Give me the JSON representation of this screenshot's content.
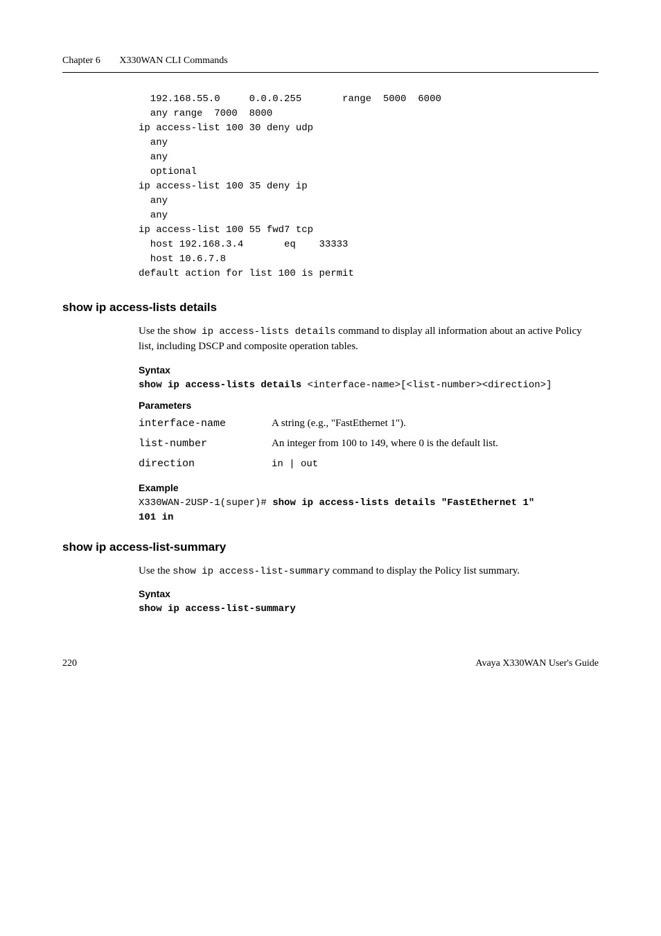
{
  "header": {
    "chapter": "Chapter 6",
    "title": "X330WAN CLI Commands"
  },
  "code_top": "  192.168.55.0     0.0.0.255       range  5000  6000\n  any range  7000  8000\nip access-list 100 30 deny udp\n  any\n  any\n  optional\nip access-list 100 35 deny ip\n  any\n  any\nip access-list 100 55 fwd7 tcp\n  host 192.168.3.4       eq    33333\n  host 10.6.7.8\ndefault action for list 100 is permit",
  "sections": {
    "details": {
      "heading": "show ip access-lists details",
      "body_prefix": "Use the ",
      "body_code": "show ip access-lists details",
      "body_suffix": " command to display all information about an active Policy list, including DSCP and composite operation tables.",
      "syntax_label": "Syntax",
      "syntax_bold": "show ip access-lists details",
      "syntax_rest": " <interface-name>[<list-number><direction>]",
      "params_label": "Parameters",
      "params": [
        {
          "name": "interface-name",
          "desc": "A string (e.g., \"FastEthernet 1\")."
        },
        {
          "name": "list-number",
          "desc": "An integer from 100 to 149, where 0 is the default list."
        },
        {
          "name": "direction",
          "desc_code": "in | out"
        }
      ],
      "example_label": "Example",
      "example_prefix": "X330WAN-2USP-1(super)# ",
      "example_bold_1": "show ip access-lists details \"FastEthernet 1\"",
      "example_bold_2": "101 in"
    },
    "summary": {
      "heading": "show ip access-list-summary",
      "body_prefix": "Use the ",
      "body_code": "show ip access-list-summary",
      "body_suffix": " command to display the Policy list summary.",
      "syntax_label": "Syntax",
      "syntax_bold": "show ip access-list-summary"
    }
  },
  "footer": {
    "page": "220",
    "guide": "Avaya X330WAN User's Guide"
  }
}
